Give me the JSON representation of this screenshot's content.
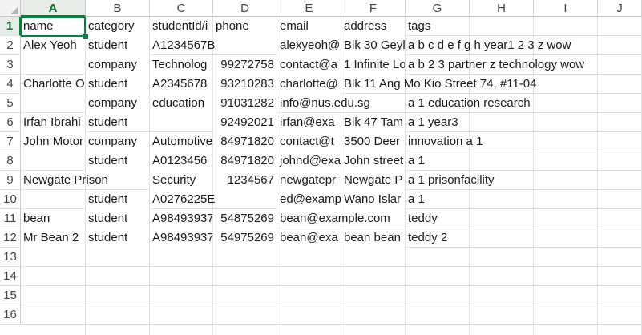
{
  "sheet": {
    "columns": [
      "A",
      "B",
      "C",
      "D",
      "E",
      "F",
      "G",
      "H",
      "I",
      "J"
    ],
    "rows": [
      "1",
      "2",
      "3",
      "4",
      "5",
      "6",
      "7",
      "8",
      "9",
      "10",
      "11",
      "12",
      "13",
      "14",
      "15",
      "16"
    ],
    "active_column": "A",
    "active_row": "1",
    "accent_color": "#107c41",
    "cells": [
      [
        "name",
        "category",
        "studentId/i",
        "phone",
        "email",
        "address",
        "tags"
      ],
      [
        "Alex Yeoh",
        "student",
        "A1234567B",
        "",
        "alexyeoh@",
        "Blk 30 Geyl",
        "a b c d e f g h year1 2 3 z wow"
      ],
      [
        "",
        "company",
        "Technolog",
        "99272758",
        "contact@a",
        "1 Infinite Lo",
        "a b 2 3 partner z technology wow"
      ],
      [
        "Charlotte O",
        "student",
        "A2345678",
        "93210283",
        "charlotte@",
        "Blk 11 Ang Mo Kio Street 74, #11-04",
        ""
      ],
      [
        "",
        "company",
        "education",
        "91031282",
        "info@nus.edu.sg",
        "",
        "a 1 education research"
      ],
      [
        "Irfan Ibrahi",
        "student",
        "",
        "92492021",
        "irfan@exa",
        "Blk 47 Tam",
        "a 1 year3"
      ],
      [
        "John Motor",
        "company",
        "Automotive",
        "84971820",
        "contact@t",
        "3500 Deer",
        "innovation a 1"
      ],
      [
        "",
        "student",
        "A0123456",
        "84971820",
        "johnd@exa",
        "John street",
        "a 1"
      ],
      [
        "Newgate Prison",
        "",
        "Security",
        "1234567",
        "newgatepr",
        "Newgate P",
        "a 1 prisonfacility"
      ],
      [
        "",
        "student",
        "A0276225E",
        "",
        "ed@examp",
        "Wano Islar",
        "a 1"
      ],
      [
        "bean",
        "student",
        "A98493937",
        "54875269",
        "bean@example.com",
        "",
        "teddy"
      ],
      [
        "Mr Bean 2",
        "student",
        "A98493937",
        "54975269",
        "bean@exa",
        "bean bean",
        "teddy 2"
      ]
    ]
  }
}
